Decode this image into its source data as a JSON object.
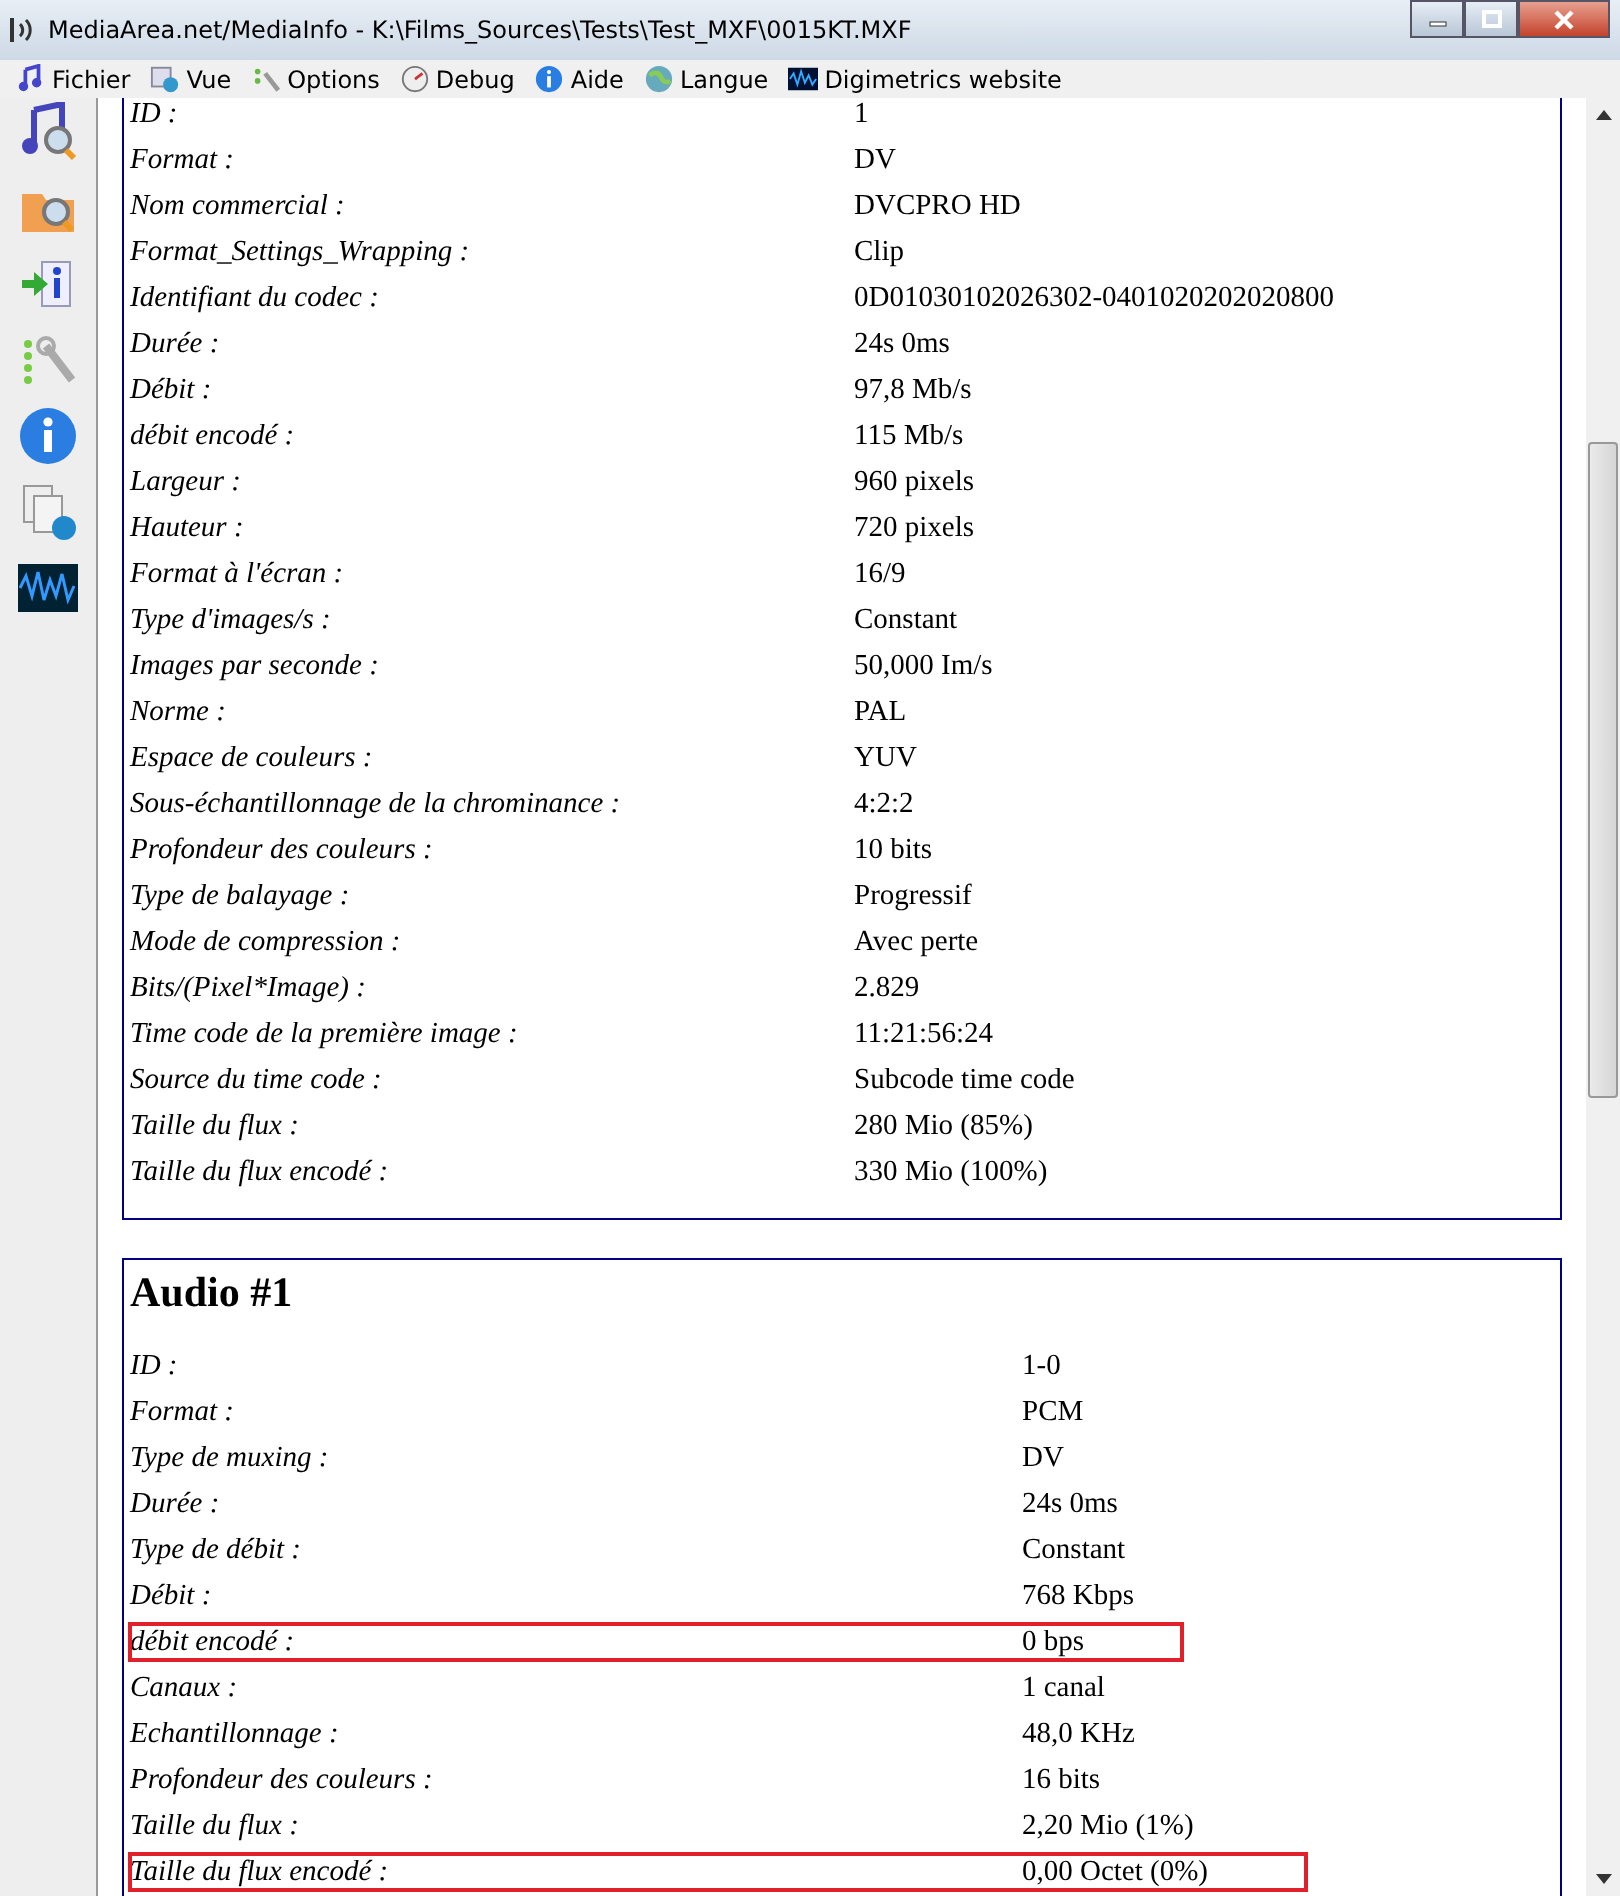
{
  "window": {
    "title": "MediaArea.net/MediaInfo - K:\\Films_Sources\\Tests\\Test_MXF\\0015KT.MXF"
  },
  "menu": [
    "Fichier",
    "Vue",
    "Options",
    "Debug",
    "Aide",
    "Langue",
    "Digimetrics website"
  ],
  "sections": [
    {
      "kind": "video",
      "rows": [
        {
          "label": "ID :",
          "value": "1"
        },
        {
          "label": "Format :",
          "value": "DV"
        },
        {
          "label": "Nom commercial :",
          "value": "DVCPRO HD"
        },
        {
          "label": "Format_Settings_Wrapping :",
          "value": "Clip"
        },
        {
          "label": "Identifiant du codec :",
          "value": "0D01030102026302-0401020202020800"
        },
        {
          "label": "Durée :",
          "value": "24s 0ms"
        },
        {
          "label": "Débit :",
          "value": "97,8 Mb/s"
        },
        {
          "label": "débit encodé :",
          "value": "115 Mb/s"
        },
        {
          "label": "Largeur :",
          "value": "960 pixels"
        },
        {
          "label": "Hauteur :",
          "value": "720 pixels"
        },
        {
          "label": "Format à l'écran :",
          "value": "16/9"
        },
        {
          "label": "Type d'images/s :",
          "value": "Constant"
        },
        {
          "label": "Images par seconde :",
          "value": "50,000 Im/s"
        },
        {
          "label": "Norme :",
          "value": "PAL"
        },
        {
          "label": "Espace de couleurs :",
          "value": "YUV"
        },
        {
          "label": "Sous-échantillonnage de la chrominance :",
          "value": "4:2:2"
        },
        {
          "label": "Profondeur des couleurs :",
          "value": "10 bits"
        },
        {
          "label": "Type de balayage :",
          "value": "Progressif"
        },
        {
          "label": "Mode de compression :",
          "value": "Avec perte"
        },
        {
          "label": "Bits/(Pixel*Image) :",
          "value": "2.829"
        },
        {
          "label": "Time code de la première image :",
          "value": "11:21:56:24"
        },
        {
          "label": "Source du time code :",
          "value": "Subcode time code"
        },
        {
          "label": "Taille du flux :",
          "value": "280 Mio (85%)"
        },
        {
          "label": "Taille du flux encodé :",
          "value": "330 Mio (100%)"
        }
      ]
    },
    {
      "kind": "audio",
      "title": "Audio #1",
      "rows": [
        {
          "label": "ID :",
          "value": "1-0",
          "highlighted": false
        },
        {
          "label": "Format :",
          "value": "PCM",
          "highlighted": false
        },
        {
          "label": "Type de muxing :",
          "value": "DV",
          "highlighted": false
        },
        {
          "label": "Durée :",
          "value": "24s 0ms",
          "highlighted": false
        },
        {
          "label": "Type de débit :",
          "value": "Constant",
          "highlighted": false
        },
        {
          "label": "Débit :",
          "value": "768 Kbps",
          "highlighted": false
        },
        {
          "label": "débit encodé :",
          "value": "0 bps",
          "highlighted": true
        },
        {
          "label": "Canaux :",
          "value": "1 canal",
          "highlighted": false
        },
        {
          "label": "Echantillonnage :",
          "value": "48,0 KHz",
          "highlighted": false
        },
        {
          "label": "Profondeur des couleurs :",
          "value": "16 bits",
          "highlighted": false
        },
        {
          "label": "Taille du flux :",
          "value": "2,20 Mio (1%)",
          "highlighted": false
        },
        {
          "label": "Taille du flux encodé :",
          "value": "0,00 Octet (0%)",
          "highlighted": true
        }
      ]
    }
  ]
}
